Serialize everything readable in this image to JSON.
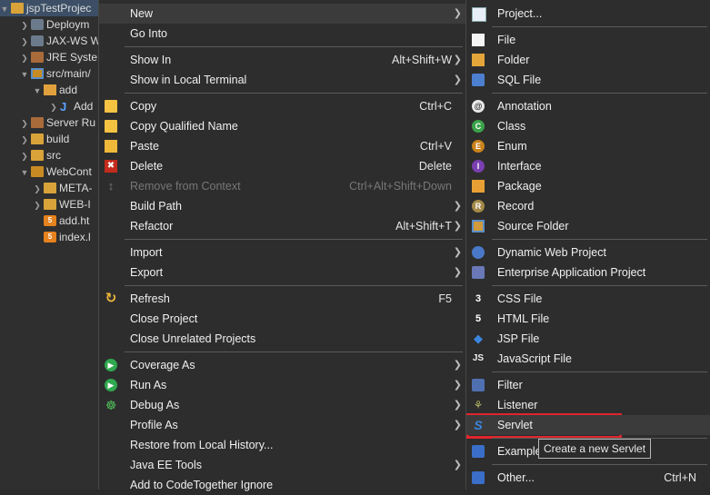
{
  "tree": {
    "items": [
      {
        "label": "jspTestProjec",
        "kind": "project"
      },
      {
        "label": "Deploym",
        "kind": "lib"
      },
      {
        "label": "JAX-WS W",
        "kind": "lib"
      },
      {
        "label": "JRE Syste",
        "kind": "books"
      },
      {
        "label": "src/main/",
        "kind": "jsrc"
      },
      {
        "label": "add",
        "kind": "pkg"
      },
      {
        "label": "Add",
        "kind": "java"
      },
      {
        "label": "Server Ru",
        "kind": "books"
      },
      {
        "label": "build",
        "kind": "folder"
      },
      {
        "label": "src",
        "kind": "folder"
      },
      {
        "label": "WebCont",
        "kind": "folder-open"
      },
      {
        "label": "META-",
        "kind": "folder"
      },
      {
        "label": "WEB-I",
        "kind": "folder"
      },
      {
        "label": "add.ht",
        "kind": "html"
      },
      {
        "label": "index.l",
        "kind": "html"
      }
    ]
  },
  "menu1": {
    "items": [
      {
        "label": "New",
        "submenu": true
      },
      {
        "label": "Go Into"
      },
      {
        "sep": true
      },
      {
        "label": "Show In",
        "accel": "Alt+Shift+W",
        "submenu": true
      },
      {
        "label": "Show in Local Terminal",
        "submenu": true
      },
      {
        "sep": true
      },
      {
        "label": "Copy",
        "accel": "Ctrl+C",
        "icon": "copy-icon"
      },
      {
        "label": "Copy Qualified Name",
        "icon": "copy-qualified-icon"
      },
      {
        "label": "Paste",
        "accel": "Ctrl+V",
        "icon": "paste-icon"
      },
      {
        "label": "Delete",
        "accel": "Delete",
        "icon": "delete-icon"
      },
      {
        "label": "Remove from Context",
        "accel": "Ctrl+Alt+Shift+Down",
        "icon": "remove-context-icon",
        "disabled": true
      },
      {
        "label": "Build Path",
        "submenu": true
      },
      {
        "label": "Refactor",
        "accel": "Alt+Shift+T",
        "submenu": true
      },
      {
        "sep": true
      },
      {
        "label": "Import",
        "submenu": true
      },
      {
        "label": "Export",
        "submenu": true
      },
      {
        "sep": true
      },
      {
        "label": "Refresh",
        "accel": "F5",
        "icon": "refresh-icon"
      },
      {
        "label": "Close Project"
      },
      {
        "label": "Close Unrelated Projects"
      },
      {
        "sep": true
      },
      {
        "label": "Coverage As",
        "submenu": true,
        "icon": "coverage-icon"
      },
      {
        "label": "Run As",
        "submenu": true,
        "icon": "run-icon"
      },
      {
        "label": "Debug As",
        "submenu": true,
        "icon": "debug-icon"
      },
      {
        "label": "Profile As",
        "submenu": true
      },
      {
        "label": "Restore from Local History..."
      },
      {
        "label": "Java EE Tools",
        "submenu": true
      },
      {
        "label": "Add to CodeTogether Ignore"
      }
    ]
  },
  "menu2": {
    "items": [
      {
        "label": "Project...",
        "icon": "project-icon"
      },
      {
        "sep": true
      },
      {
        "label": "File",
        "icon": "file-icon"
      },
      {
        "label": "Folder",
        "icon": "folder-icon"
      },
      {
        "label": "SQL File",
        "icon": "sql-file-icon"
      },
      {
        "sep": true
      },
      {
        "label": "Annotation",
        "icon": "annotation-icon"
      },
      {
        "label": "Class",
        "icon": "class-icon"
      },
      {
        "label": "Enum",
        "icon": "enum-icon"
      },
      {
        "label": "Interface",
        "icon": "interface-icon"
      },
      {
        "label": "Package",
        "icon": "package-icon"
      },
      {
        "label": "Record",
        "icon": "record-icon"
      },
      {
        "label": "Source Folder",
        "icon": "source-folder-icon"
      },
      {
        "sep": true
      },
      {
        "label": "Dynamic Web Project",
        "icon": "dynamic-web-project-icon"
      },
      {
        "label": "Enterprise Application Project",
        "icon": "enterprise-app-icon"
      },
      {
        "sep": true
      },
      {
        "label": "CSS File",
        "icon": "css-file-icon"
      },
      {
        "label": "HTML File",
        "icon": "html-file-icon"
      },
      {
        "label": "JSP File",
        "icon": "jsp-file-icon"
      },
      {
        "label": "JavaScript File",
        "icon": "javascript-file-icon"
      },
      {
        "sep": true
      },
      {
        "label": "Filter",
        "icon": "filter-icon"
      },
      {
        "label": "Listener",
        "icon": "listener-icon"
      },
      {
        "label": "Servlet",
        "icon": "servlet-icon",
        "highlight": true
      },
      {
        "sep": true
      },
      {
        "label": "Example",
        "icon": "example-icon"
      },
      {
        "sep": true
      },
      {
        "label": "Other...",
        "accel": "Ctrl+N",
        "icon": "other-icon"
      }
    ]
  },
  "tooltip": "Create a new Servlet",
  "colors": {
    "highlight_box": "#e0252d",
    "menu_bg": "#2d2d2d"
  }
}
